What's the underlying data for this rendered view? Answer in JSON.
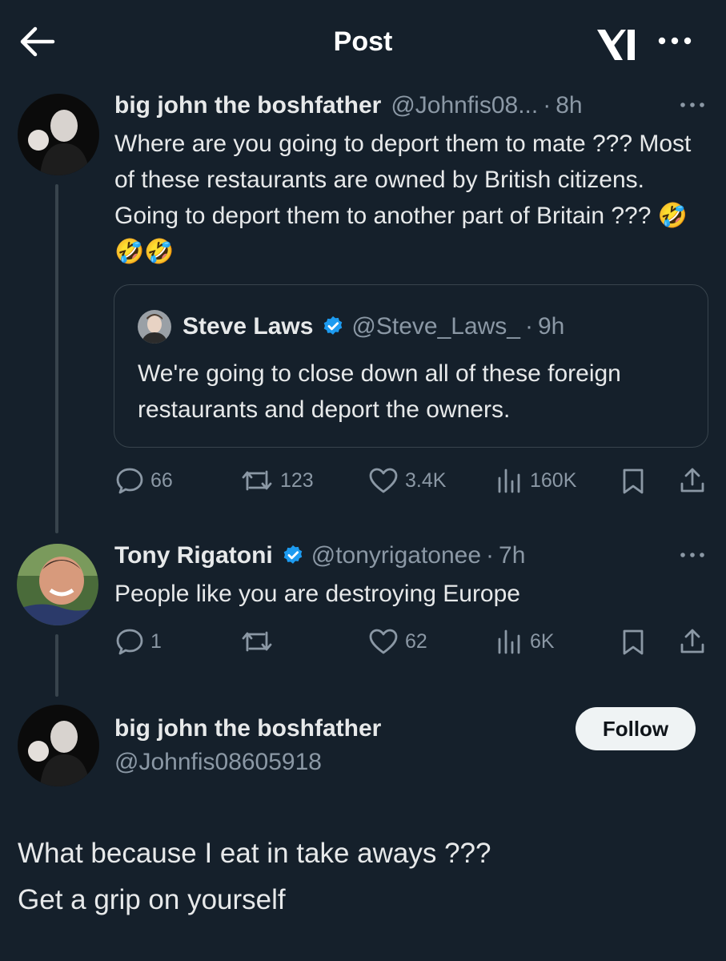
{
  "header": {
    "title": "Post"
  },
  "reply1": {
    "name": "big john the boshfather",
    "handle": "@Johnfis08...",
    "dot": "·",
    "time": "8h",
    "text": "Where are you going to deport them to mate ??? Most of these restaurants are owned by British citizens. Going to deport them to another part of Britain ??? 🤣🤣🤣",
    "quote": {
      "name": "Steve Laws",
      "handle": "@Steve_Laws_",
      "dot": "·",
      "time": "9h",
      "text": "We're going to close down all of these foreign restaurants and deport the owners."
    },
    "actions": {
      "replies": "66",
      "reposts": "123",
      "likes": "3.4K",
      "views": "160K"
    }
  },
  "reply2": {
    "name": "Tony Rigatoni",
    "handle": "@tonyrigatonee",
    "dot": "·",
    "time": "7h",
    "text": "People like you are destroying Europe",
    "actions": {
      "replies": "1",
      "reposts": "",
      "likes": "62",
      "views": "6K"
    }
  },
  "main": {
    "name": "big john the boshfather",
    "handle": "@Johnfis08605918",
    "follow_label": "Follow",
    "line1": "What because I eat in take aways ???",
    "line2": "Get a grip on yourself"
  },
  "colors": {
    "background": "#15202b",
    "verified": "#1d9bf0",
    "muted": "#8b98a5"
  }
}
